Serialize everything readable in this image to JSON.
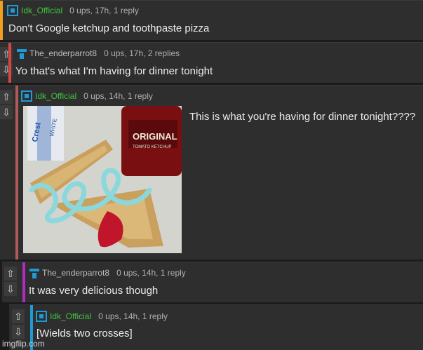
{
  "comments": [
    {
      "user": "Idk_Official",
      "meta": "0 ups, 17h, 1 reply",
      "text": "Don't Google ketchup and toothpaste pizza",
      "bar_color": "#f0a020",
      "user_color": "#41c341"
    },
    {
      "user": "The_enderparrot8",
      "meta": "0 ups, 17h, 2 replies",
      "text": "Yo that's what I'm having for dinner tonight",
      "bar_color": "#d94545",
      "user_color": "#bdbdbd"
    },
    {
      "user": "Idk_Official",
      "meta": "0 ups, 14h, 1 reply",
      "text": "This is what you're having for dinner tonight????",
      "bar_color": "#b05a5a",
      "user_color": "#41c341"
    },
    {
      "user": "The_enderparrot8",
      "meta": "0 ups, 14h, 1 reply",
      "text": "It was very delicious though",
      "bar_color": "#b02cc0",
      "user_color": "#bdbdbd"
    },
    {
      "user": "Idk_Official",
      "meta": "0 ups, 14h, 1 reply",
      "text": "[Wields two crosses]",
      "bar_color": "#1f9ad6",
      "user_color": "#41c341"
    }
  ],
  "icons": {
    "upvote": "arrow-up-icon",
    "downvote": "arrow-down-icon"
  },
  "image": {
    "label_crest": "Crest",
    "label_white": "WHITE",
    "label_original": "ORIGINAL",
    "label_ketchup": "TOMATO KETCHUP"
  },
  "watermark": "imgflip.com"
}
